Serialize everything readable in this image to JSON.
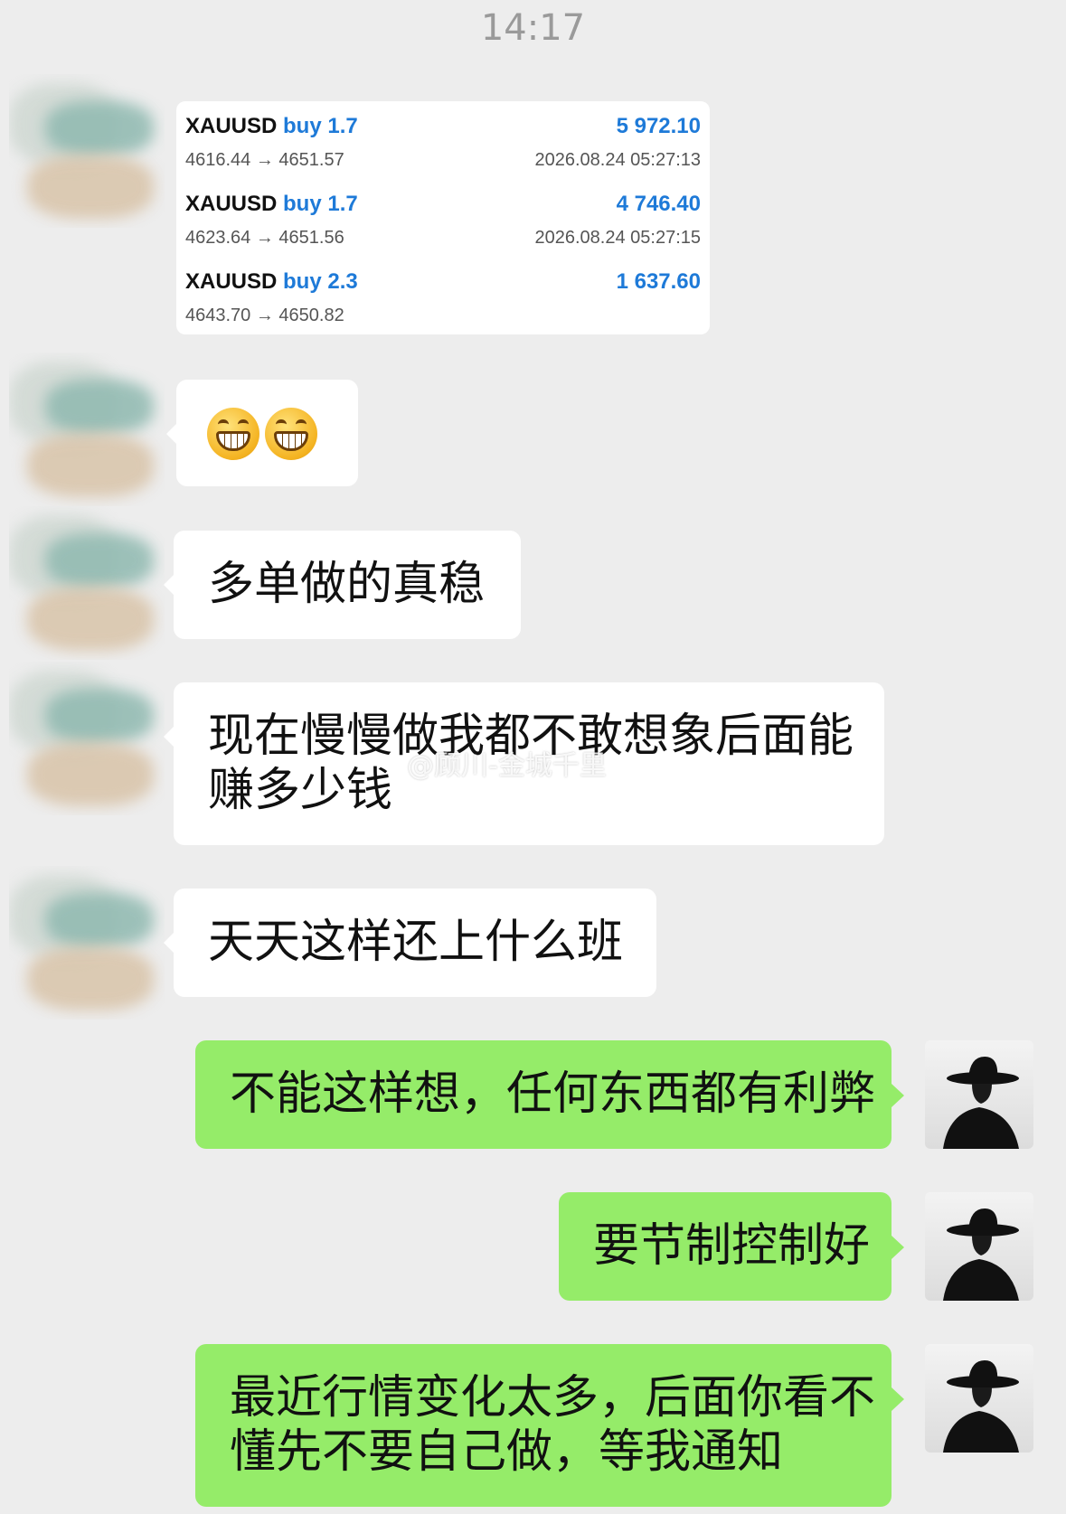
{
  "status": {
    "time": "14:17"
  },
  "trades": [
    {
      "symbol": "XAUUSD",
      "direction": "buy",
      "lots": "1.7",
      "profit": "5 972.10",
      "open": "4616.44",
      "close": "4651.57",
      "timestamp": "2026.08.24 05:27:13"
    },
    {
      "symbol": "XAUUSD",
      "direction": "buy",
      "lots": "1.7",
      "profit": "4 746.40",
      "open": "4623.64",
      "close": "4651.56",
      "timestamp": "2026.08.24 05:27:15"
    },
    {
      "symbol": "XAUUSD",
      "direction": "buy",
      "lots": "2.3",
      "profit": "1 637.60",
      "open": "4643.70",
      "close": "4650.82",
      "timestamp": ""
    }
  ],
  "messages": [
    {
      "side": "left",
      "type": "emoji",
      "emoji_icon": "grinning-face-icon"
    },
    {
      "side": "left",
      "text": "多单做的真稳"
    },
    {
      "side": "left",
      "line1": "现在慢慢做我都不敢想象后面能",
      "line2": "赚多少钱"
    },
    {
      "side": "left",
      "text": "天天这样还上什么班"
    },
    {
      "side": "right",
      "text": "不能这样想，任何东西都有利弊"
    },
    {
      "side": "right",
      "text": "要节制控制好"
    },
    {
      "side": "right",
      "line1": "最近行情变化太多，后面你看不",
      "line2": "懂先不要自己做，等我通知"
    }
  ],
  "watermark": "@顾川-金城千里",
  "colors": {
    "background": "#ededed",
    "self_bubble": "#95ec69",
    "other_bubble": "#ffffff",
    "trade_accent": "#1e7ad8"
  }
}
